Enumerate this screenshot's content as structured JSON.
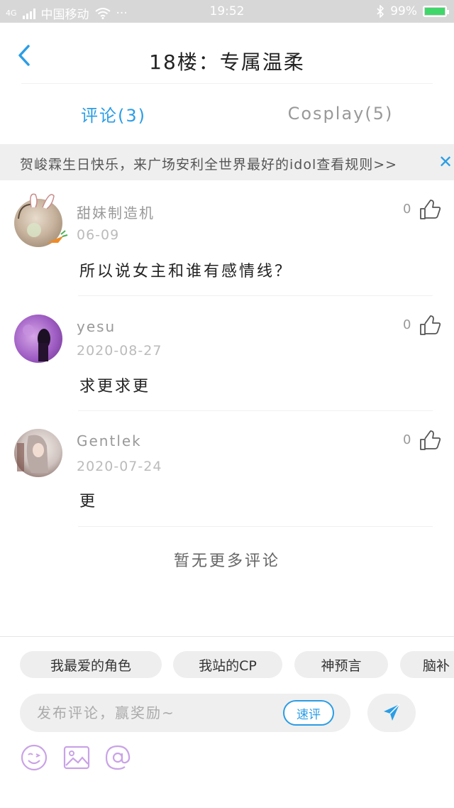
{
  "status_bar": {
    "network_tag": "4G",
    "carrier": "中国移动",
    "more": "···",
    "time": "19:52",
    "battery": "99%",
    "battery_level": 0.99
  },
  "header": {
    "title": "18楼：专属温柔"
  },
  "tabs": [
    {
      "label": "评论(3)",
      "active": true
    },
    {
      "label": "Cosplay(5)",
      "active": false
    }
  ],
  "notice": {
    "text": "贺峻霖生日快乐，来广场安利全世界最好的idol查看规则>>"
  },
  "comments": [
    {
      "name": "甜妹制造机",
      "date": "06-09",
      "body": "所以说女主和谁有感情线？",
      "likes": "0"
    },
    {
      "name": "yesu",
      "date": "2020-08-27",
      "body": "求更求更",
      "likes": "0"
    },
    {
      "name": "Gentlek",
      "date": "2020-07-24",
      "body": "更",
      "likes": "0"
    }
  ],
  "end_note": "暂无更多评论",
  "chips": [
    "我最爱的角色",
    "我站的CP",
    "神预言",
    "脑补"
  ],
  "input": {
    "placeholder": "发布评论，赢奖励~",
    "quick_label": "速评"
  },
  "colors": {
    "accent": "#2b9de5",
    "tool_icon": "#c9a3e6"
  },
  "icons": {
    "back": "chevron-left-icon",
    "close": "close-icon",
    "like": "thumbs-up-icon",
    "send": "send-icon",
    "tools": [
      "emoji-icon",
      "image-icon",
      "at-icon"
    ]
  }
}
